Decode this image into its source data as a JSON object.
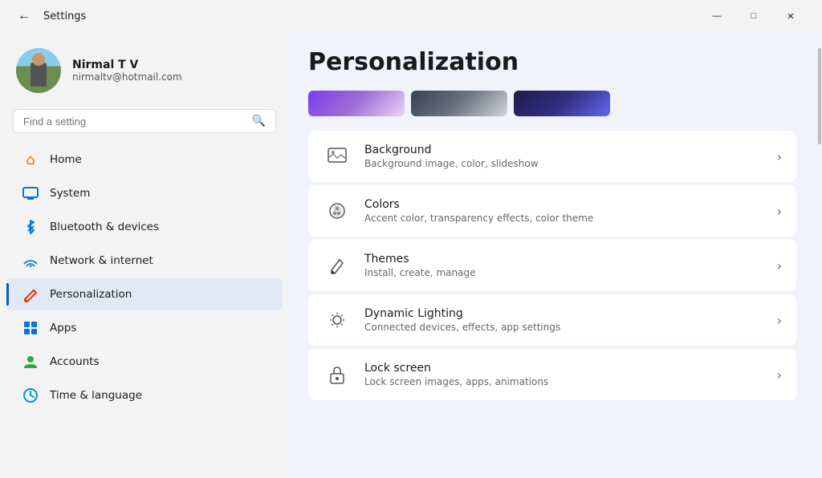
{
  "titleBar": {
    "title": "Settings",
    "back": "←",
    "minimize": "—",
    "maximize": "□",
    "close": "✕"
  },
  "profile": {
    "name": "Nirmal T V",
    "email": "nirmaltv@hotmail.com"
  },
  "search": {
    "placeholder": "Find a setting"
  },
  "nav": {
    "items": [
      {
        "id": "home",
        "label": "Home",
        "icon": "home"
      },
      {
        "id": "system",
        "label": "System",
        "icon": "system"
      },
      {
        "id": "bluetooth",
        "label": "Bluetooth & devices",
        "icon": "bluetooth"
      },
      {
        "id": "network",
        "label": "Network & internet",
        "icon": "network"
      },
      {
        "id": "personalization",
        "label": "Personalization",
        "icon": "personalization",
        "active": true
      },
      {
        "id": "apps",
        "label": "Apps",
        "icon": "apps"
      },
      {
        "id": "accounts",
        "label": "Accounts",
        "icon": "accounts"
      },
      {
        "id": "time",
        "label": "Time & language",
        "icon": "time"
      }
    ]
  },
  "page": {
    "title": "Personalization",
    "themeColors": [
      "#7c3aed",
      "#374151",
      "#1e1b4b"
    ]
  },
  "settings": {
    "items": [
      {
        "id": "background",
        "title": "Background",
        "description": "Background image, color, slideshow",
        "icon": "🖼"
      },
      {
        "id": "colors",
        "title": "Colors",
        "description": "Accent color, transparency effects, color theme",
        "icon": "🎨"
      },
      {
        "id": "themes",
        "title": "Themes",
        "description": "Install, create, manage",
        "icon": "✏"
      },
      {
        "id": "dynamic-lighting",
        "title": "Dynamic Lighting",
        "description": "Connected devices, effects, app settings",
        "icon": "⚙"
      },
      {
        "id": "lock-screen",
        "title": "Lock screen",
        "description": "Lock screen images, apps, animations",
        "icon": "🔒"
      }
    ]
  }
}
